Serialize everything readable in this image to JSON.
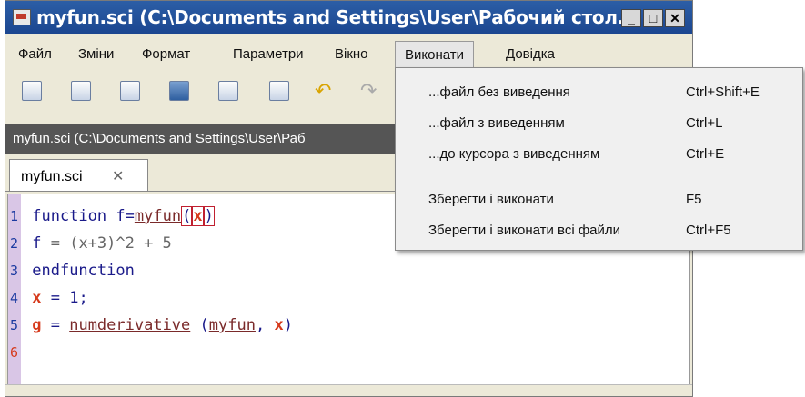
{
  "window": {
    "title": "myfun.sci (C:\\Documents and Settings\\User\\Рабочий стол...",
    "controls": [
      "_",
      "□",
      "✕"
    ]
  },
  "menubar": [
    "Файл",
    "Зміни",
    "Формат",
    "Параметри",
    "Вікно",
    "Виконати",
    "Довідка"
  ],
  "toolbar": {
    "icons": [
      "new-file-icon",
      "open-file-icon",
      "save-icon",
      "save-as-icon",
      "print-preview-icon",
      "print-icon",
      "undo-icon",
      "redo-icon"
    ]
  },
  "pathbar": {
    "text": "myfun.sci (C:\\Documents and Settings\\User\\Раб"
  },
  "tab": {
    "label": "myfun.sci",
    "close": "✕"
  },
  "editor": {
    "lines": [
      {
        "num": "1"
      },
      {
        "num": "2"
      },
      {
        "num": "3"
      },
      {
        "num": "4"
      },
      {
        "num": "5"
      },
      {
        "num": "6"
      }
    ],
    "code": {
      "l1_a": "function",
      "l1_b": "f=",
      "l1_fn": "myfun",
      "l1_p1": "(",
      "l1_x": "x",
      "l1_p2": ")",
      "l2_a": "f",
      "l2_b": " = (x+3)^2 + 5",
      "l3_a": "endfunction",
      "l4_a": "x",
      "l4_b": " = 1;",
      "l5_a": "g",
      "l5_b": " = ",
      "l5_fn": "numderivative",
      "l5_c": " (",
      "l5_fn2": "myfun",
      "l5_d": ", ",
      "l5_x": "x",
      "l5_e": ")"
    }
  },
  "dropdown": {
    "items": [
      {
        "label": "...файл без виведення",
        "shortcut": "Ctrl+Shift+E"
      },
      {
        "label": "...файл з виведенням",
        "shortcut": "Ctrl+L"
      },
      {
        "label": "...до курсора з виведенням",
        "shortcut": "Ctrl+E"
      },
      {
        "label": "Зберегти і виконати",
        "shortcut": "F5"
      },
      {
        "label": "Зберегти і виконати всі файли",
        "shortcut": "Ctrl+F5"
      }
    ]
  }
}
